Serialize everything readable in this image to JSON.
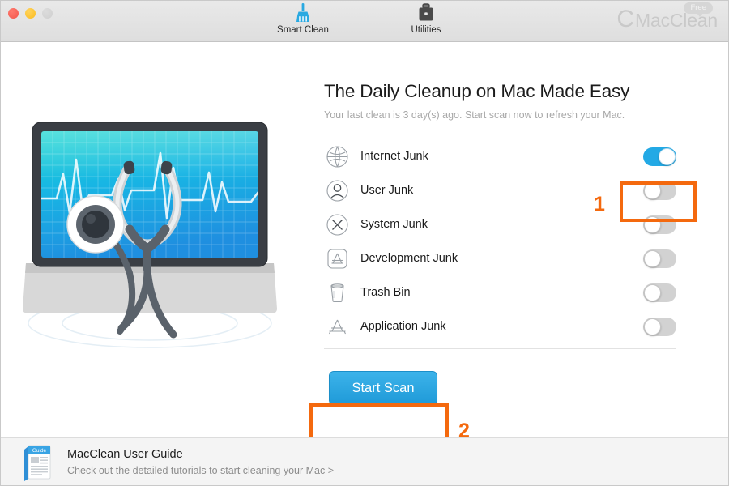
{
  "window": {
    "traffic_lights": [
      "close",
      "minimize",
      "zoom"
    ]
  },
  "toolbar": {
    "items": [
      {
        "label": "Smart Clean",
        "icon": "broom-icon",
        "active": true
      },
      {
        "label": "Utilities",
        "icon": "briefcase-icon",
        "active": false
      }
    ]
  },
  "brand": {
    "mark": "C",
    "name": "MacClean",
    "badge": "Free"
  },
  "main": {
    "headline": "The Daily Cleanup on Mac Made Easy",
    "subline": "Your last clean is 3 day(s) ago. Start scan now to refresh your Mac.",
    "items": [
      {
        "label": "Internet Junk",
        "icon": "globe-icon",
        "enabled": true
      },
      {
        "label": "User Junk",
        "icon": "user-icon",
        "enabled": false
      },
      {
        "label": "System Junk",
        "icon": "x-circle-icon",
        "enabled": false
      },
      {
        "label": "Development Junk",
        "icon": "xcode-icon",
        "enabled": false
      },
      {
        "label": "Trash Bin",
        "icon": "trash-icon",
        "enabled": false
      },
      {
        "label": "Application Junk",
        "icon": "appstore-icon",
        "enabled": false
      }
    ],
    "start_button": "Start Scan"
  },
  "annotations": [
    {
      "number": "1",
      "target": "internet-junk-toggle"
    },
    {
      "number": "2",
      "target": "start-scan-button"
    }
  ],
  "footer": {
    "title": "MacClean User Guide",
    "subtitle": "Check out the detailed tutorials to start cleaning your Mac >",
    "icon_label": "Guide"
  },
  "colors": {
    "accent_blue": "#23a9e5",
    "annotation_orange": "#f4690e",
    "toggle_off": "#d2d2d2",
    "text_primary": "#1b1b1b",
    "text_muted": "#a8a8a8"
  }
}
